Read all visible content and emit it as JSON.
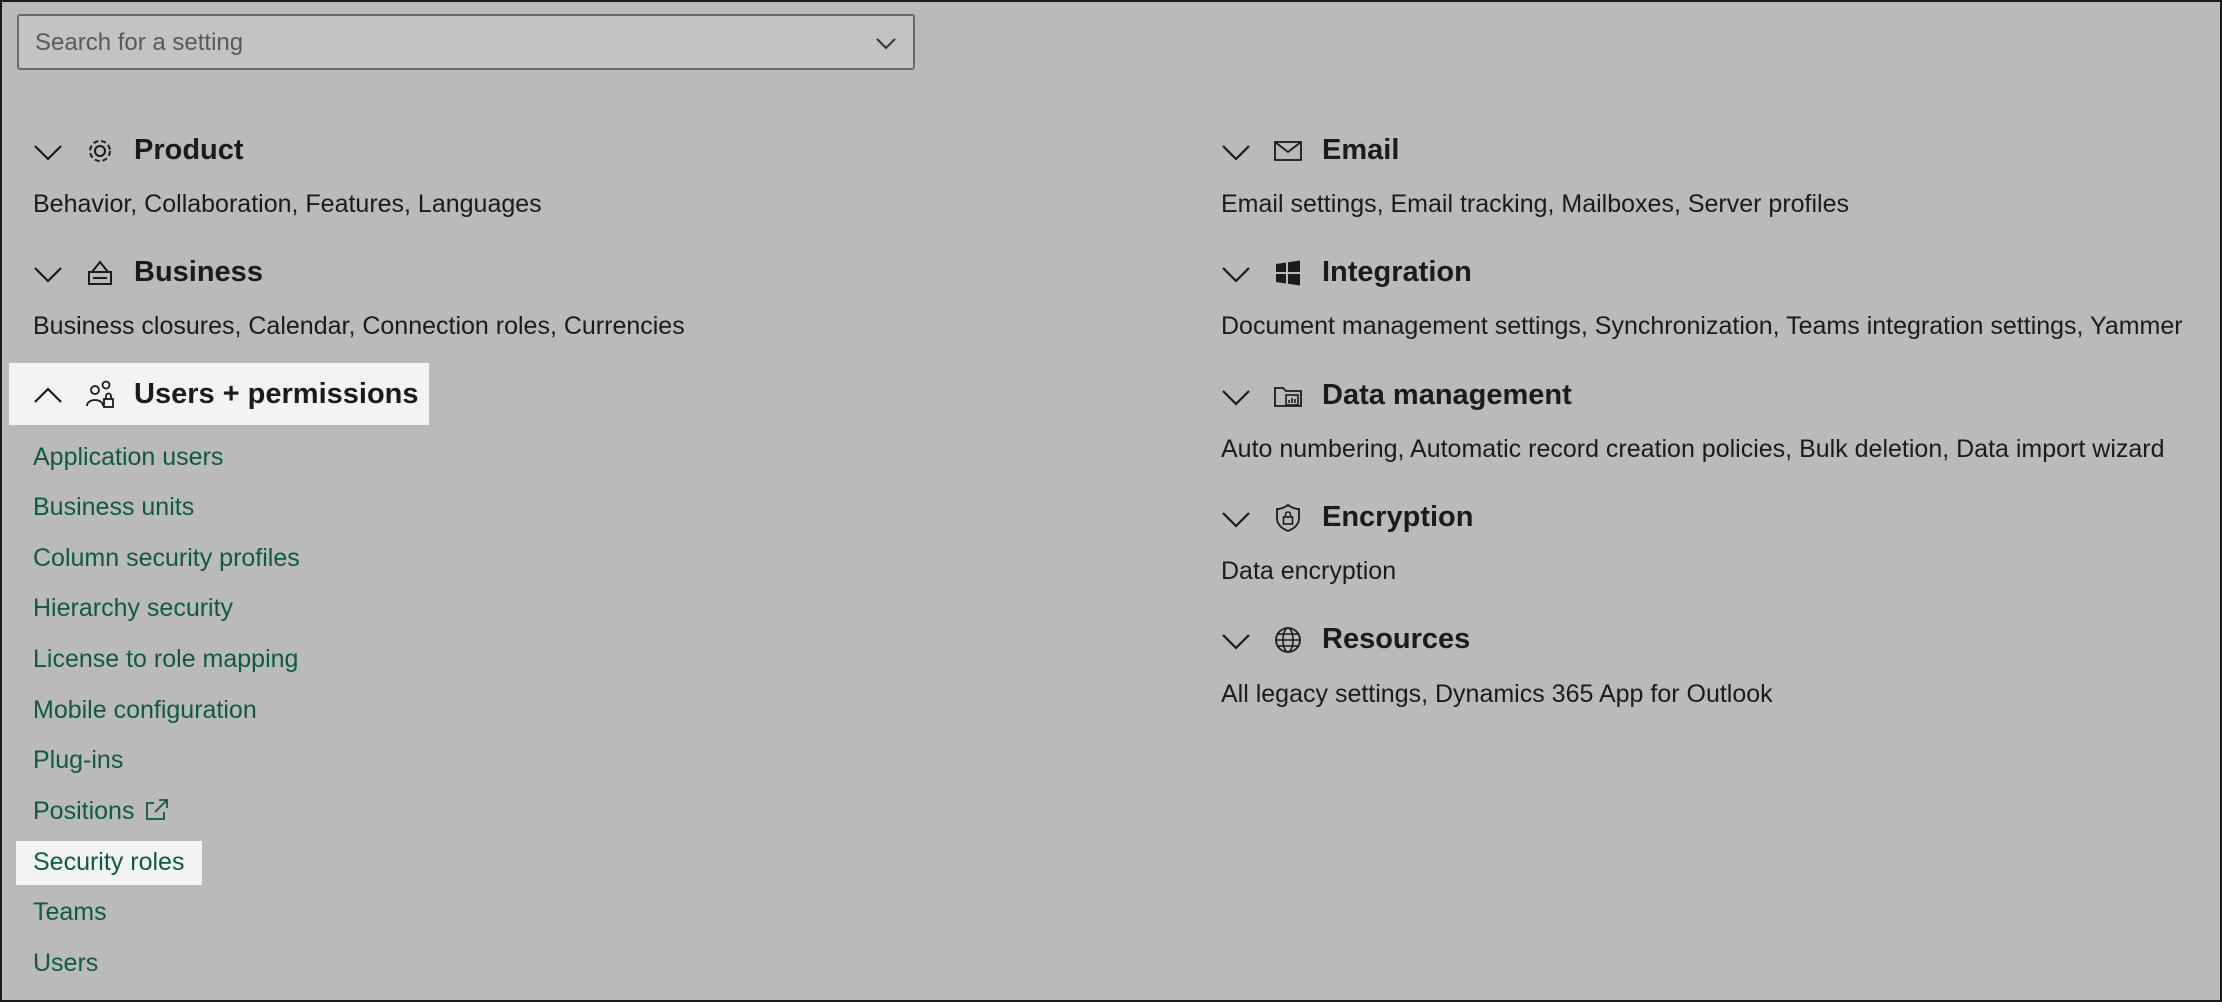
{
  "search": {
    "placeholder": "Search for a setting"
  },
  "left_groups": [
    {
      "title": "Product",
      "icon": "gear-icon",
      "expanded": false,
      "summary": "Behavior, Collaboration, Features, Languages"
    },
    {
      "title": "Business",
      "icon": "business-icon",
      "expanded": false,
      "summary": "Business closures, Calendar, Connection roles, Currencies"
    },
    {
      "title": "Users + permissions",
      "icon": "users-lock-icon",
      "expanded": true,
      "items": [
        {
          "label": "Application users"
        },
        {
          "label": "Business units"
        },
        {
          "label": "Column security profiles"
        },
        {
          "label": "Hierarchy security"
        },
        {
          "label": "License to role mapping"
        },
        {
          "label": "Mobile configuration"
        },
        {
          "label": "Plug-ins"
        },
        {
          "label": "Positions",
          "external": true
        },
        {
          "label": "Security roles",
          "highlighted": true
        },
        {
          "label": "Teams"
        },
        {
          "label": "Users"
        }
      ]
    }
  ],
  "right_groups": [
    {
      "title": "Email",
      "icon": "mail-icon",
      "expanded": false,
      "summary": "Email settings, Email tracking, Mailboxes, Server profiles"
    },
    {
      "title": "Integration",
      "icon": "windows-icon",
      "expanded": false,
      "summary": "Document management settings, Synchronization, Teams integration settings, Yammer"
    },
    {
      "title": "Data management",
      "icon": "data-folder-icon",
      "expanded": false,
      "summary": "Auto numbering, Automatic record creation policies, Bulk deletion, Data import wizard"
    },
    {
      "title": "Encryption",
      "icon": "shield-lock-icon",
      "expanded": false,
      "summary": "Data encryption"
    },
    {
      "title": "Resources",
      "icon": "globe-icon",
      "expanded": false,
      "summary": "All legacy settings, Dynamics 365 App for Outlook"
    }
  ],
  "colors": {
    "background": "#bababa",
    "link": "#0e5a45",
    "highlight": "#f3f3f3"
  }
}
